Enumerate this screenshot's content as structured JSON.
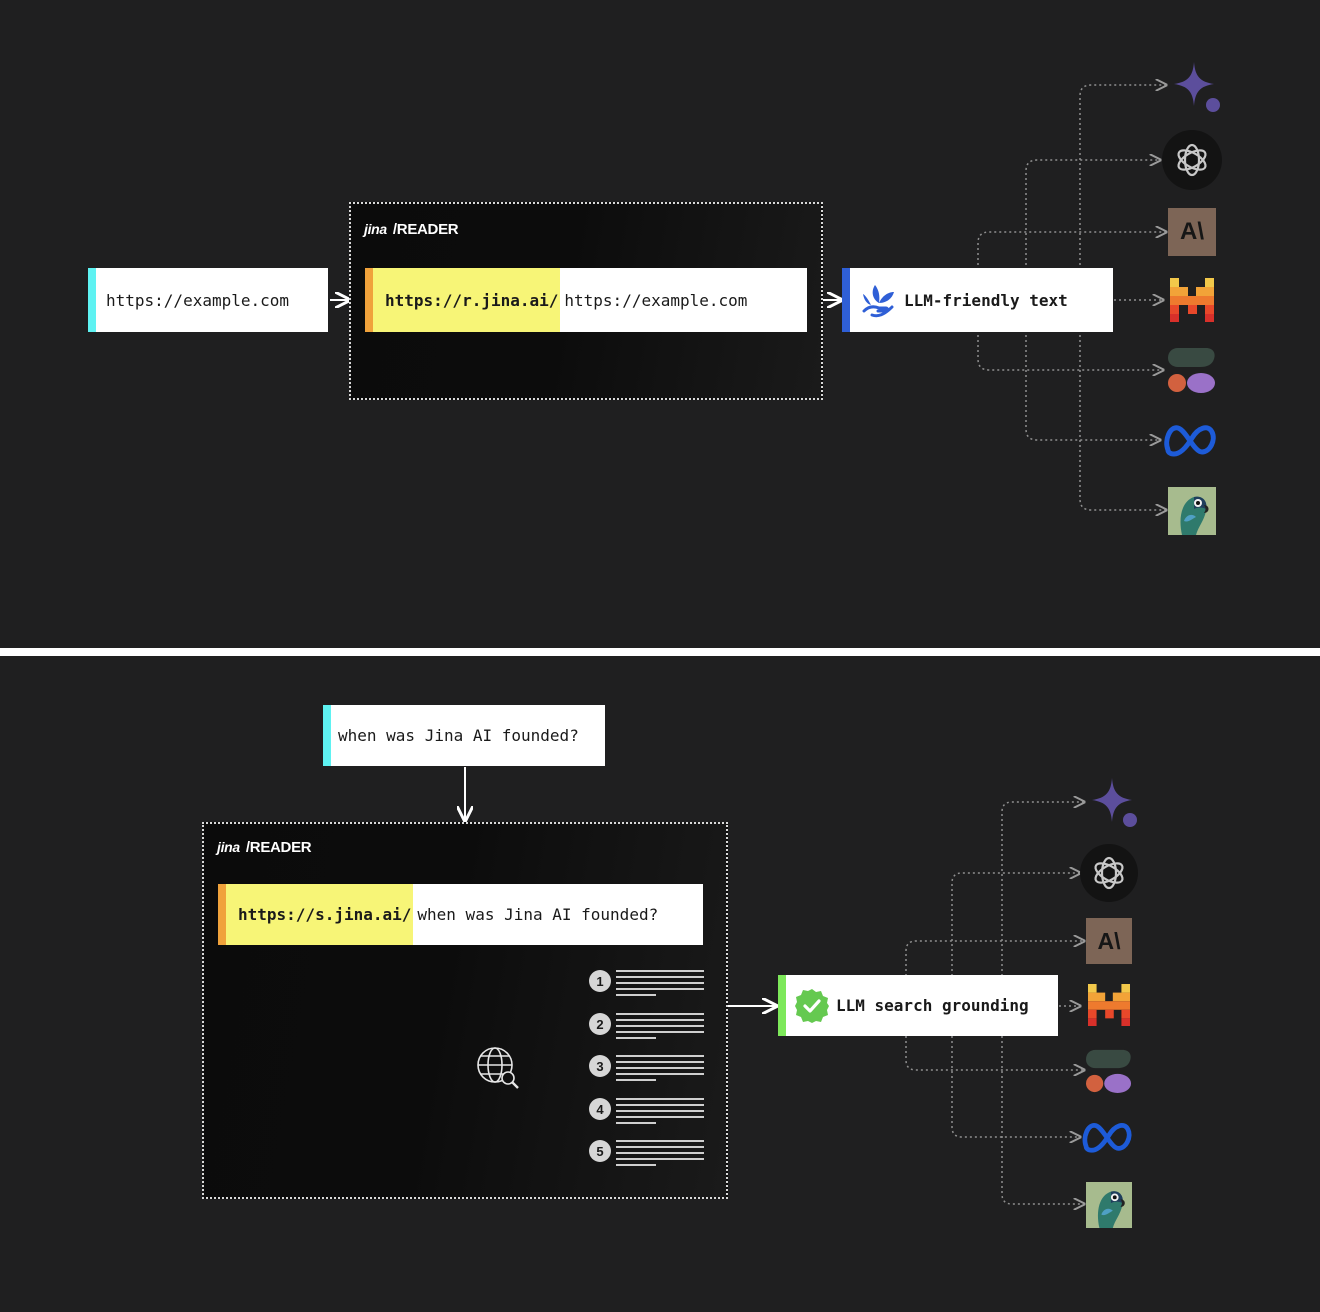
{
  "top": {
    "input_url": "https://example.com",
    "reader": {
      "brand_logo": "jina",
      "brand_path": "/READER",
      "prefix": "https://r.jina.ai/",
      "suffix": "https://example.com"
    },
    "output_label": "LLM-friendly text",
    "output_icon": "hand-sprout-icon"
  },
  "bottom": {
    "query": "when was Jina AI founded?",
    "reader": {
      "brand_logo": "jina",
      "brand_path": "/READER",
      "prefix": "https://s.jina.ai/",
      "suffix": "when was Jina AI founded?"
    },
    "results": [
      "1",
      "2",
      "3",
      "4",
      "5"
    ],
    "output_label": "LLM search grounding",
    "output_icon": "check-badge-icon"
  },
  "llm_icons": [
    "gemini-icon",
    "openai-icon",
    "anthropic-icon",
    "mistral-icon",
    "cohere-icon",
    "meta-icon",
    "llama-parrot-icon"
  ],
  "colors": {
    "cyan_accent": "#5ef2f2",
    "orange_accent": "#f0a23b",
    "blue_accent": "#2f5fd6",
    "green_accent": "#7de85a",
    "highlight": "#f7f577",
    "background": "#1f1f20"
  }
}
